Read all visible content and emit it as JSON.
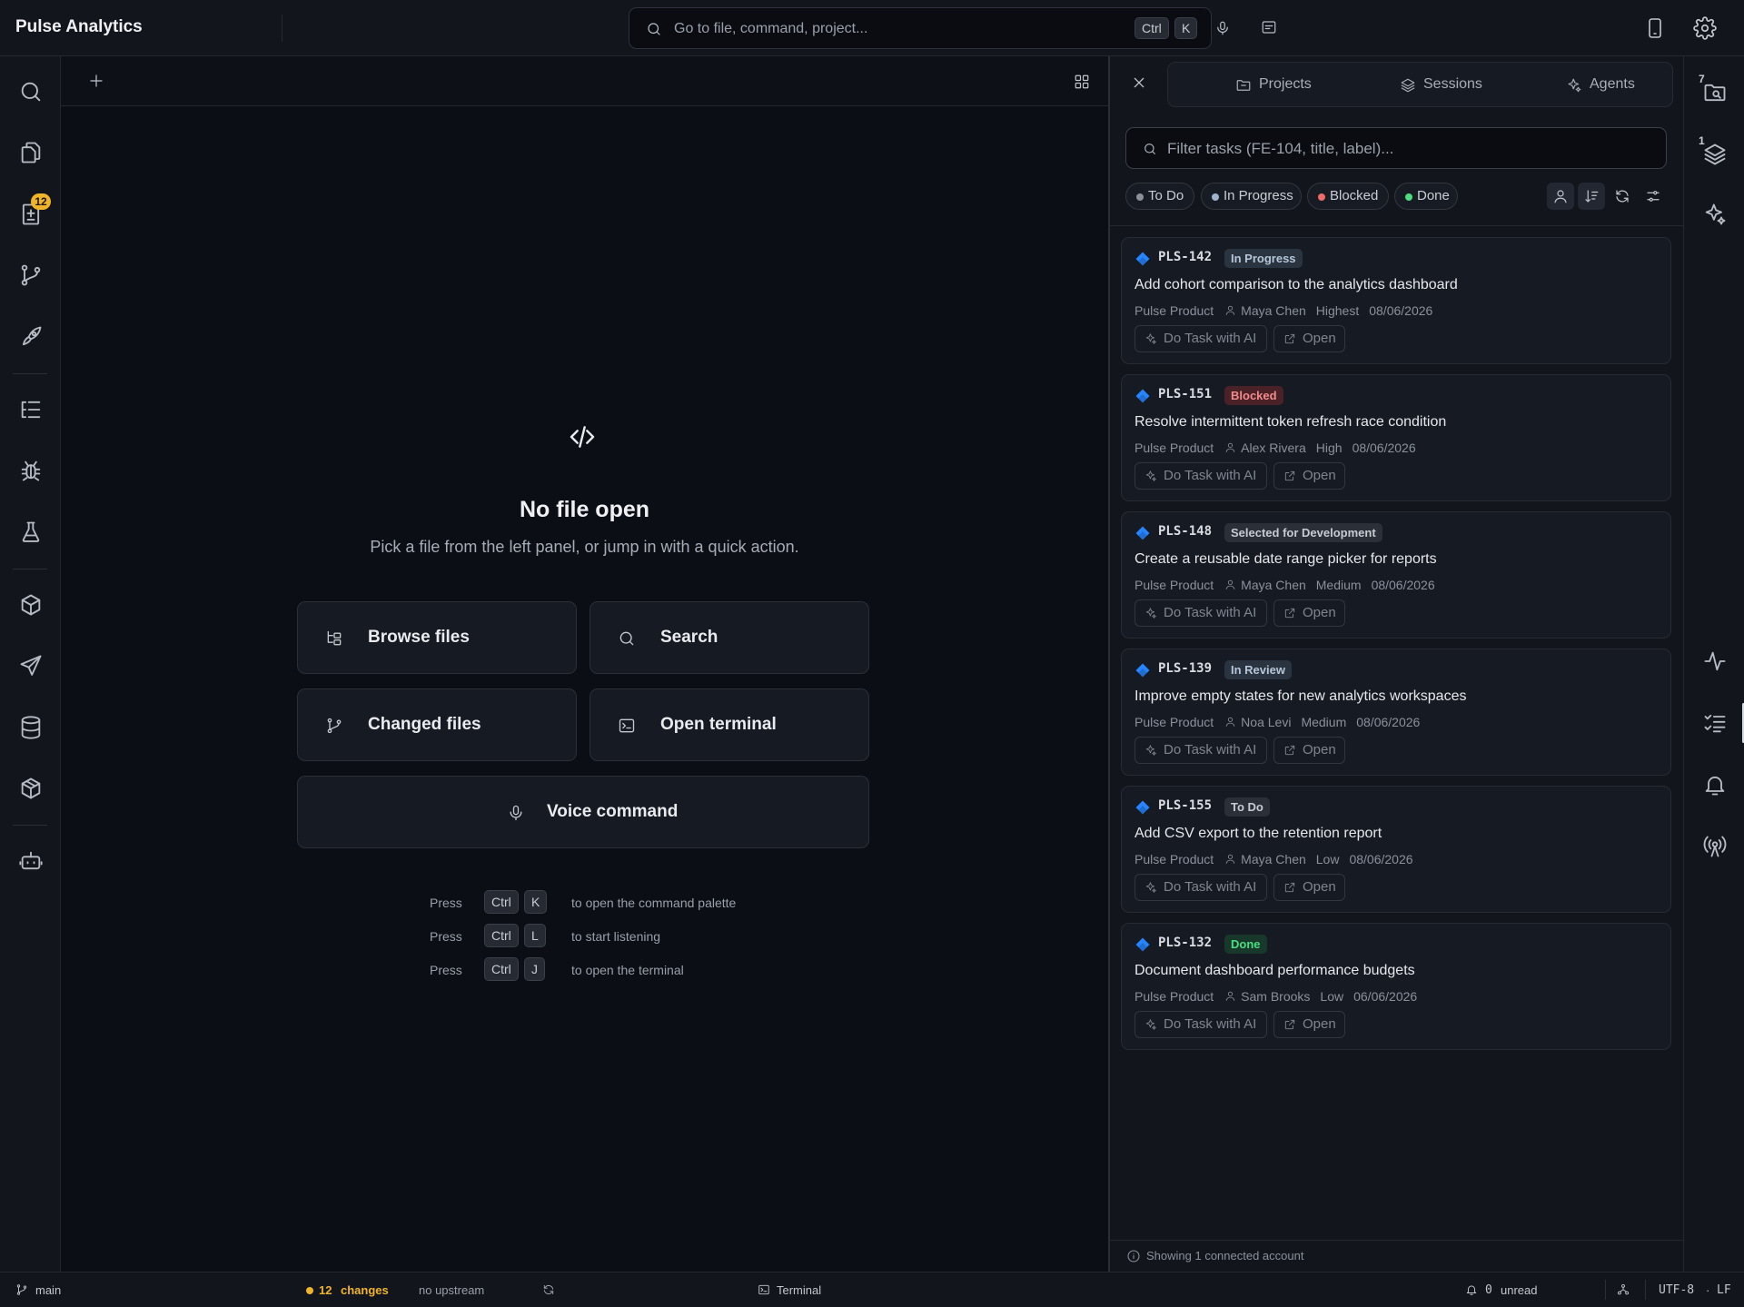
{
  "app": {
    "title": "Pulse Analytics"
  },
  "command_bar": {
    "placeholder": "Go to file, command, project...",
    "key1": "Ctrl",
    "key2": "K"
  },
  "left_bar": {
    "items": [
      {
        "name": "search",
        "icon": "search-icon"
      },
      {
        "name": "explorer",
        "icon": "files-icon"
      },
      {
        "name": "changes",
        "icon": "diff-icon",
        "badge": "12"
      },
      {
        "name": "source-control",
        "icon": "git-branch-icon"
      },
      {
        "name": "deploy",
        "icon": "rocket-icon"
      },
      {
        "name": "outline",
        "icon": "list-tree-icon"
      },
      {
        "name": "debug",
        "icon": "bug-icon"
      },
      {
        "name": "testing",
        "icon": "flask-icon"
      },
      {
        "name": "packages",
        "icon": "package-icon"
      },
      {
        "name": "send",
        "icon": "send-icon"
      },
      {
        "name": "database",
        "icon": "database-icon"
      },
      {
        "name": "containers",
        "icon": "box-icon"
      },
      {
        "name": "bot",
        "icon": "bot-icon"
      }
    ]
  },
  "editor": {
    "empty_title": "No file open",
    "empty_subtitle": "Pick a file from the left panel, or jump in with a quick action.",
    "quick_actions": {
      "browse": "Browse files",
      "search": "Search",
      "changed": "Changed files",
      "terminal": "Open terminal",
      "voice": "Voice command"
    },
    "hints": [
      {
        "press": "Press",
        "k1": "Ctrl",
        "k2": "K",
        "desc": "to open the command palette"
      },
      {
        "press": "Press",
        "k1": "Ctrl",
        "k2": "L",
        "desc": "to start listening"
      },
      {
        "press": "Press",
        "k1": "Ctrl",
        "k2": "J",
        "desc": "to open the terminal"
      }
    ]
  },
  "tasks_panel": {
    "tabs": {
      "projects": "Projects",
      "sessions": "Sessions",
      "agents": "Agents"
    },
    "filter_placeholder": "Filter tasks (FE-104, title, label)...",
    "chips": {
      "todo": {
        "label": "To Do",
        "color": "#8b919b"
      },
      "inprog": {
        "label": "In Progress",
        "color": "#9fb4cc"
      },
      "blocked": {
        "label": "Blocked",
        "color": "#f06a6a"
      },
      "done": {
        "label": "Done",
        "color": "#4ade80"
      }
    },
    "action_ai": "Do Task with AI",
    "action_open": "Open",
    "cards": [
      {
        "key": "PLS-142",
        "status": "In Progress",
        "status_bg": "#2a3441",
        "status_fg": "#b6c6d8",
        "title": "Add cohort comparison to the analytics dashboard",
        "project": "Pulse Product",
        "assignee": "Maya Chen",
        "priority": "Highest",
        "date": "08/06/2026"
      },
      {
        "key": "PLS-151",
        "status": "Blocked",
        "status_bg": "#4a2126",
        "status_fg": "#f28b8b",
        "title": "Resolve intermittent token refresh race condition",
        "project": "Pulse Product",
        "assignee": "Alex Rivera",
        "priority": "High",
        "date": "08/06/2026"
      },
      {
        "key": "PLS-148",
        "status": "Selected for Development",
        "status_bg": "#2b2f37",
        "status_fg": "#c7cbd2",
        "title": "Create a reusable date range picker for reports",
        "project": "Pulse Product",
        "assignee": "Maya Chen",
        "priority": "Medium",
        "date": "08/06/2026"
      },
      {
        "key": "PLS-139",
        "status": "In Review",
        "status_bg": "#2a3441",
        "status_fg": "#b6c6d8",
        "title": "Improve empty states for new analytics workspaces",
        "project": "Pulse Product",
        "assignee": "Noa Levi",
        "priority": "Medium",
        "date": "08/06/2026"
      },
      {
        "key": "PLS-155",
        "status": "To Do",
        "status_bg": "#2b2f37",
        "status_fg": "#c7cbd2",
        "title": "Add CSV export to the retention report",
        "project": "Pulse Product",
        "assignee": "Maya Chen",
        "priority": "Low",
        "date": "08/06/2026"
      },
      {
        "key": "PLS-132",
        "status": "Done",
        "status_bg": "#17382a",
        "status_fg": "#4ade80",
        "title": "Document dashboard performance budgets",
        "project": "Pulse Product",
        "assignee": "Sam Brooks",
        "priority": "Low",
        "date": "06/06/2026"
      }
    ],
    "footer": "Showing 1 connected account"
  },
  "right_bar": {
    "badge_top": "7",
    "badge_second": "1"
  },
  "status_bar": {
    "branch": "main",
    "changes_count": "12",
    "changes_label": "changes",
    "upstream": "no upstream",
    "terminal": "Terminal",
    "unread_count": "0",
    "unread_label": "unread",
    "encoding": "UTF-8",
    "separator": "·",
    "eol": "LF"
  },
  "colors": {
    "accent_warning": "#f0b429",
    "jira_blue": "#2684ff",
    "background": "#0b0e14"
  }
}
